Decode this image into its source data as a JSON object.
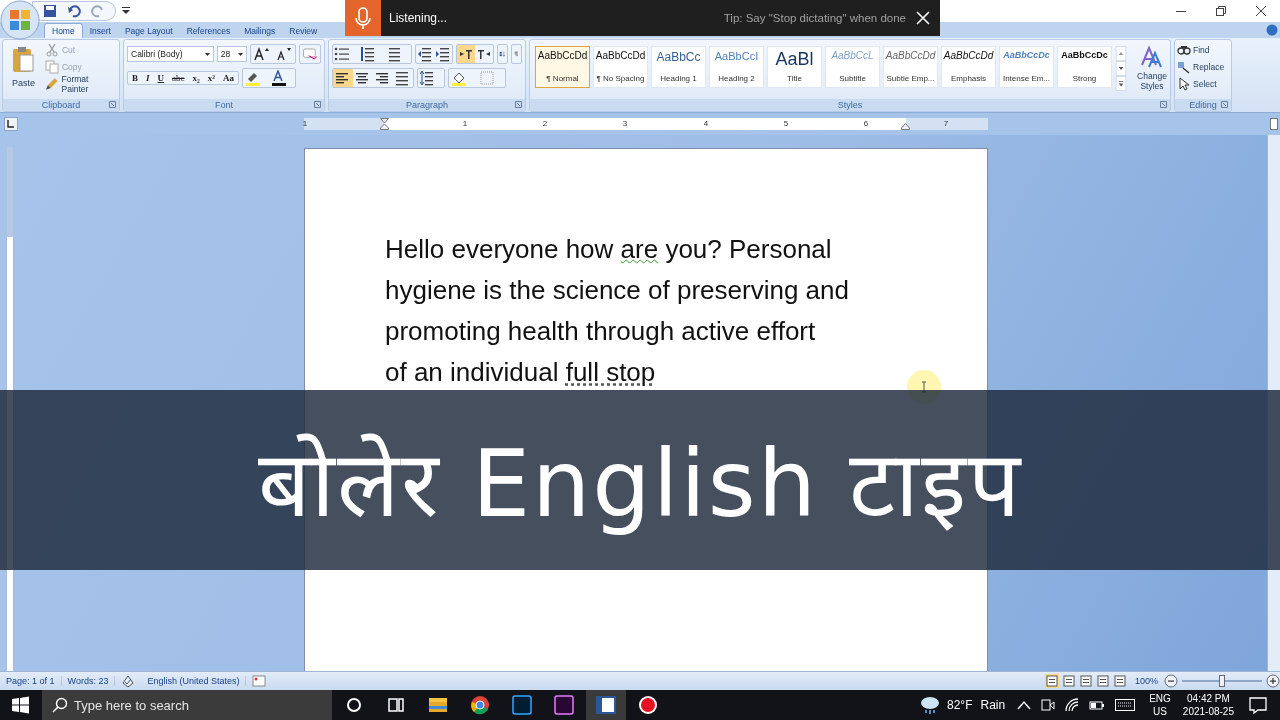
{
  "dictation": {
    "status": "Listening...",
    "tip": "Tip: Say \"Stop dictating\" when done"
  },
  "tabs": [
    {
      "label": "Home",
      "selected": true
    },
    {
      "label": "Insert",
      "selected": false
    },
    {
      "label": "Page Layout",
      "selected": false
    },
    {
      "label": "References",
      "selected": false
    },
    {
      "label": "Mailings",
      "selected": false
    },
    {
      "label": "Review",
      "selected": false
    }
  ],
  "clipboard": {
    "label": "Clipboard",
    "paste": "Paste",
    "items": [
      {
        "kind": "cut",
        "label": "Cut",
        "disabled": true
      },
      {
        "kind": "copy",
        "label": "Copy",
        "disabled": true
      },
      {
        "kind": "painter",
        "label": "Format Painter",
        "disabled": false
      }
    ]
  },
  "font": {
    "label": "Font",
    "name": "Calibri (Body)",
    "size": "28",
    "format_buttons": [
      "B",
      "I",
      "U",
      "abc",
      "x₂",
      "x²",
      "Aa"
    ]
  },
  "paragraph": {
    "label": "Paragraph",
    "alignments": [
      {
        "kind": "left",
        "selected": true
      },
      {
        "kind": "center",
        "selected": false
      },
      {
        "kind": "right",
        "selected": false
      },
      {
        "kind": "justify",
        "selected": false
      }
    ]
  },
  "styles": {
    "label": "Styles",
    "items": [
      {
        "preview": "AaBbCcDd",
        "label": "¶ Normal",
        "kind": "normal",
        "selected": true
      },
      {
        "preview": "AaBbCcDd",
        "label": "¶ No Spacing",
        "kind": "normal",
        "selected": false
      },
      {
        "preview": "AaBbCc",
        "label": "Heading 1",
        "kind": "heading1",
        "selected": false
      },
      {
        "preview": "AaBbCcI",
        "label": "Heading 2",
        "kind": "heading2",
        "selected": false
      },
      {
        "preview": "AaBl",
        "label": "Title",
        "kind": "title",
        "selected": false
      },
      {
        "preview": "AaBbCcL",
        "label": "Subtitle",
        "kind": "subtitle",
        "selected": false
      },
      {
        "preview": "AaBbCcDd",
        "label": "Subtle Emp...",
        "kind": "subtle",
        "selected": false
      },
      {
        "preview": "AaBbCcDd",
        "label": "Emphasis",
        "kind": "emphasis",
        "selected": false
      },
      {
        "preview": "AaBbCcDc",
        "label": "Intense Em...",
        "kind": "intense",
        "selected": false
      },
      {
        "preview": "AaBbCcDc",
        "label": "Strong",
        "kind": "strong",
        "selected": false
      }
    ],
    "change": "Change Styles"
  },
  "editing": {
    "label": "Editing",
    "items": [
      {
        "kind": "find",
        "label": "Find"
      },
      {
        "kind": "replace",
        "label": "Replace"
      },
      {
        "kind": "select",
        "label": "Select"
      }
    ]
  },
  "ruler": [
    "1",
    "1",
    "2",
    "3",
    "4",
    "5",
    "6",
    "7"
  ],
  "document": {
    "lines": [
      [
        {
          "text": "Hello everyone how ",
          "grammar_flag": false,
          "dictated": false
        },
        {
          "text": "are",
          "grammar_flag": true,
          "dictated": false
        },
        {
          "text": " you? Personal",
          "grammar_flag": false,
          "dictated": false
        }
      ],
      [
        {
          "text": "hygiene is the science of preserving and",
          "grammar_flag": false,
          "dictated": false
        }
      ],
      [
        {
          "text": "promoting health through active effort",
          "grammar_flag": false,
          "dictated": false
        }
      ],
      [
        {
          "text": "of an individual ",
          "grammar_flag": false,
          "dictated": false
        },
        {
          "text": "full stop",
          "grammar_flag": false,
          "dictated": true
        }
      ]
    ]
  },
  "caption": "बोलेर English टाइप",
  "status_bar": {
    "page": "Page: 1 of 1",
    "words": "Words: 23",
    "language": "English (United States)",
    "zoom": "100%",
    "zoom_slider": {
      "level": 0.5
    }
  },
  "taskbar": {
    "search_placeholder": "Type here to search",
    "temperature": "82°F",
    "weather": "Rain",
    "language": "ENG",
    "region": "US",
    "time": "04:42 PM",
    "date": "2021-08-25"
  }
}
